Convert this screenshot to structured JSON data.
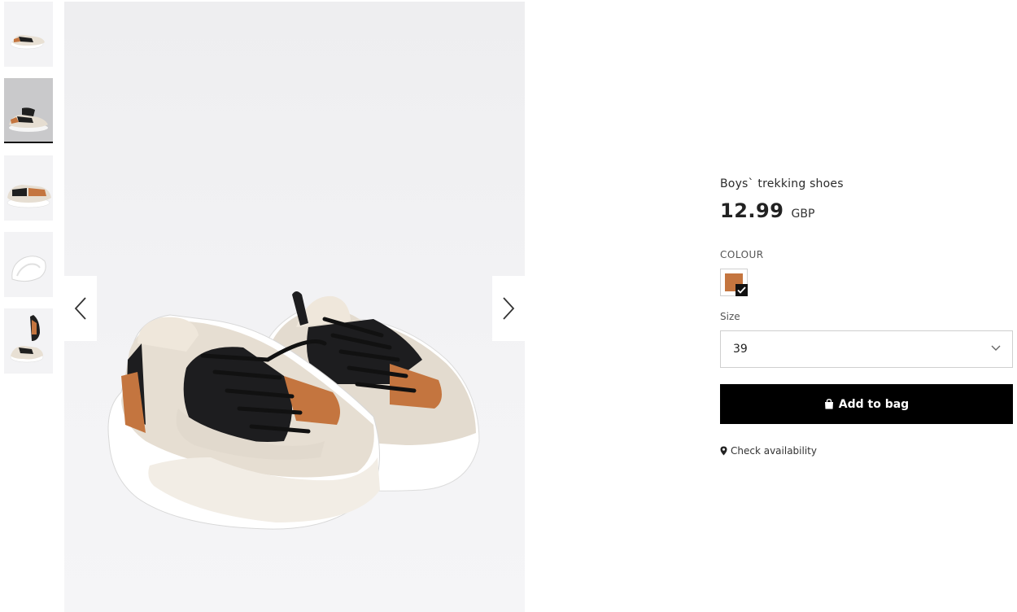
{
  "gallery": {
    "thumbnails": [
      {
        "icon": "shoe-pair-thumbnail",
        "active": false
      },
      {
        "icon": "shoe-pair-thumbnail",
        "active": true
      },
      {
        "icon": "shoe-side-thumbnail",
        "active": false
      },
      {
        "icon": "shoe-sole-thumbnail",
        "active": false
      },
      {
        "icon": "shoe-stacked-thumbnail",
        "active": false
      }
    ],
    "prev_icon": "chevron-left-icon",
    "next_icon": "chevron-right-icon"
  },
  "product": {
    "title": "Boys` trekking shoes",
    "price": "12.99",
    "currency": "GBP",
    "colour_label": "COLOUR",
    "colour_swatch": "#c4753f",
    "size_label": "Size",
    "size_value": "39",
    "add_to_bag": "Add to bag",
    "check_availability": "Check availability"
  }
}
